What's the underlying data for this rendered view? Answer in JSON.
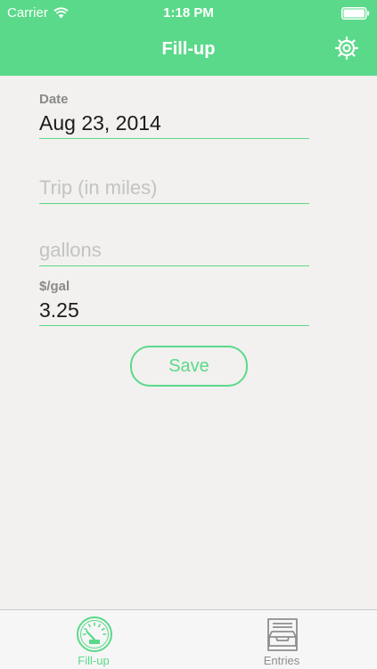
{
  "status_bar": {
    "carrier": "Carrier",
    "time": "1:18 PM"
  },
  "header": {
    "title": "Fill-up",
    "settings_icon": "gear-icon"
  },
  "form": {
    "date": {
      "label": "Date",
      "value": "Aug 23, 2014"
    },
    "trip": {
      "placeholder": "Trip (in miles)"
    },
    "gallons": {
      "placeholder": "gallons"
    },
    "price": {
      "label": "$/gal",
      "value": "3.25"
    },
    "save_label": "Save"
  },
  "tabs": [
    {
      "label": "Fill-up",
      "icon": "speedometer-icon",
      "active": true
    },
    {
      "label": "Entries",
      "icon": "inbox-tray-icon",
      "active": false
    }
  ],
  "colors": {
    "accent": "#5bd98a",
    "background": "#f2f1ef",
    "placeholder": "#c3c3c3"
  }
}
